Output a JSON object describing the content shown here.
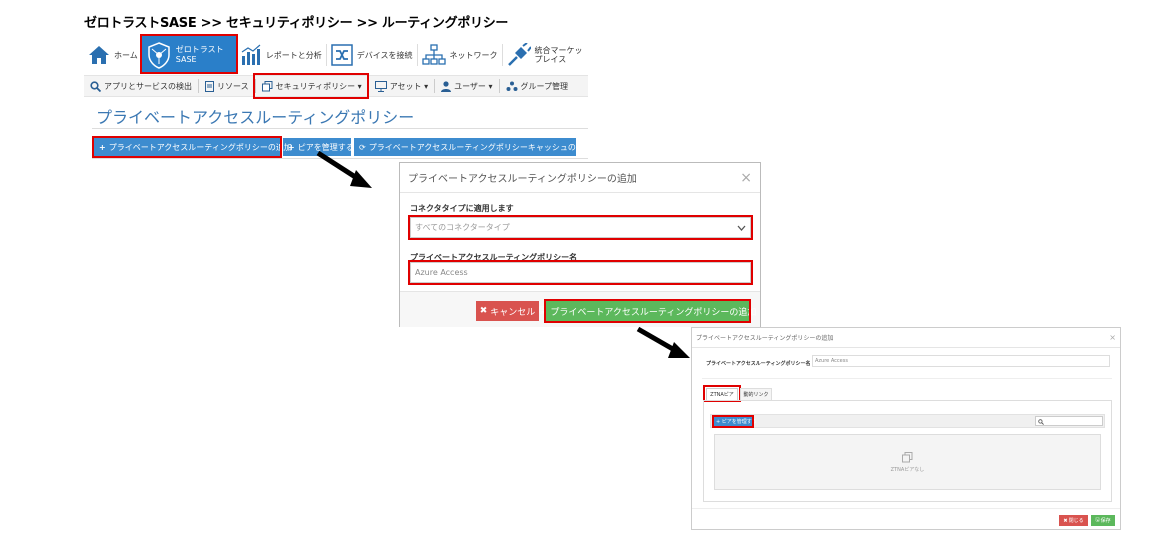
{
  "breadcrumb": "ゼロトラストSASE >> セキュリティポリシー >> ルーティングポリシー",
  "topnav": {
    "home": "ホーム",
    "ztsase_line1": "ゼロトラスト",
    "ztsase_line2": "SASE",
    "reports": "レポートと分析",
    "devices": "デバイスを接続",
    "network": "ネットワーク",
    "marketplace_line1": "統合マーケッ",
    "marketplace_line2": "プレイス"
  },
  "subnav": {
    "discover": "アプリとサービスの検出",
    "resources": "リソース",
    "security": "セキュリティポリシー ▾",
    "assets": "アセット ▾",
    "users": "ユーザー ▾",
    "groups": "グループ管理"
  },
  "page": {
    "title": "プライベートアクセスルーティングポリシー",
    "add_button": "プライベートアクセスルーティングポリシーの追加",
    "manage_peers_button": "ピアを管理する",
    "clear_cache_button": "プライベートアクセスルーティングポリシーキャッシュの消去"
  },
  "modal1": {
    "title": "プライベートアクセスルーティングポリシーの追加",
    "close": "×",
    "connector_label": "コネクタタイプに適用します",
    "connector_value": "すべてのコネクタータイプ",
    "name_label": "プライベートアクセスルーティングポリシー名",
    "name_value": "Azure Access",
    "cancel": "キャンセル",
    "add": "プライベートアクセスルーティングポリシーの追加"
  },
  "modal2": {
    "title": "プライベートアクセスルーティングポリシーの追加",
    "close": "×",
    "name_label": "プライベートアクセスルーティングポリシー名",
    "name_value": "Azure Access",
    "tab_peers": "ZTNAピア",
    "tab_dynamic": "動的リンク",
    "manage_peers": "+ ピアを管理する",
    "empty_text": "ZTNAピアなし",
    "close_button": "閉じる",
    "save_button": "保存"
  },
  "colors": {
    "accent_blue": "#2a7fc9",
    "button_blue": "#3d8ccf",
    "highlight_red": "#e00000",
    "cancel_red": "#d9534f",
    "save_green": "#5cb85c"
  }
}
